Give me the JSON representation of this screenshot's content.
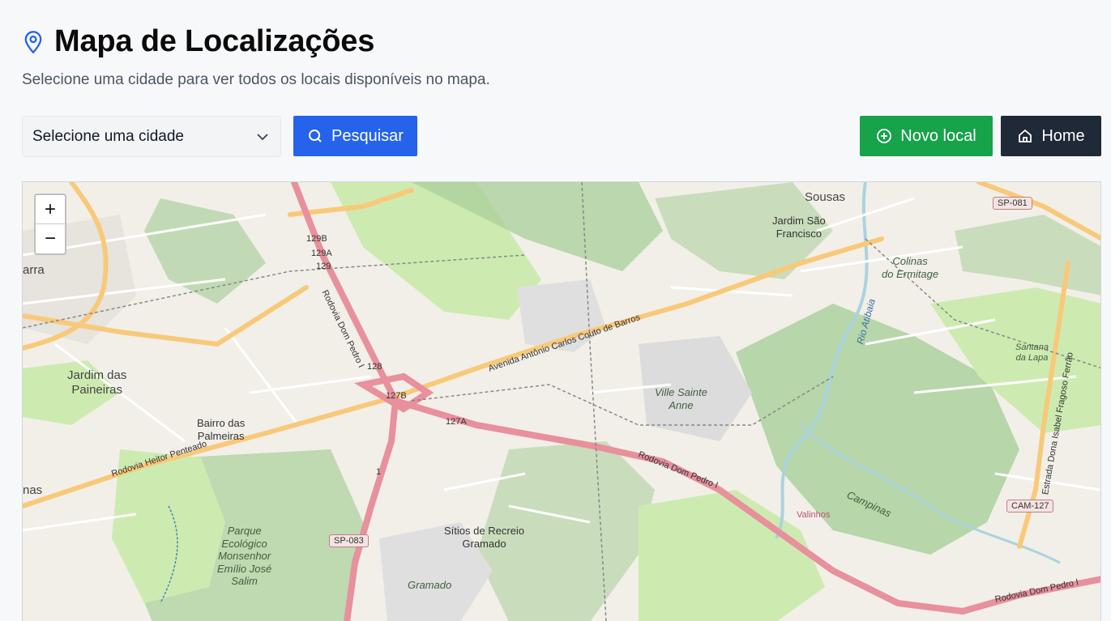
{
  "header": {
    "title": "Mapa de Localizações",
    "subtitle": "Selecione uma cidade para ver todos os locais disponíveis no mapa.",
    "icon": "map-pin-icon"
  },
  "controls": {
    "city_select": {
      "value": "Selecione uma cidade"
    },
    "search_label": "Pesquisar",
    "new_location_label": "Novo local",
    "home_label": "Home"
  },
  "map": {
    "zoom_in": "+",
    "zoom_out": "−",
    "labels": {
      "sousas": "Sousas",
      "jardim_sao_francisco": "Jardim São\nFrancisco",
      "colinas": "Colinas\ndo Ermitage",
      "santana": "Santana\nda Lapa",
      "jardim_paineiras": "Jardim das\nPaineiras",
      "bairro_palmeiras": "Bairro das\nPalmeiras",
      "ville_sainte_anne": "Ville Sainte\nAnne",
      "sitios": "Sítios de Recreio\nGramado",
      "gramado": "Gramado",
      "parque": "Parque\nEcológico\nMonsenhor\nEmílio José\nSalim",
      "valinhos": "Valinhos",
      "campinas": "Campinas",
      "rio_atibaia": "Rio Atibaia",
      "arra": "arra",
      "nas": "nas"
    },
    "roads": {
      "av_antonio": "Avenida Antônio Carlos Couto de Barros",
      "dom_pedro_1": "Rodovia Dom Pedro I",
      "dom_pedro_2": "Rodovia Dom Pedro I",
      "dom_pedro_3": "Rodovia Dom Pedro I",
      "heitor": "Rodovia Heitor Penteado",
      "estrada": "Estrada Dona Isabel Fragoso Ferrão"
    },
    "shields": {
      "sp081": "SP-081",
      "sp083": "SP-083",
      "cam127": "CAM-127",
      "r129b": "129B",
      "r129a": "129A",
      "r129": "129",
      "r128": "128",
      "r127b": "127B",
      "r127a": "127A",
      "r1": "1"
    }
  },
  "colors": {
    "search": "#2563eb",
    "new": "#16a34a",
    "home": "#1f2937",
    "motorway": "#e8909c",
    "primary": "#f8c979",
    "park": "#cdebb0",
    "forest": "#add19e",
    "water": "#aad3df"
  }
}
